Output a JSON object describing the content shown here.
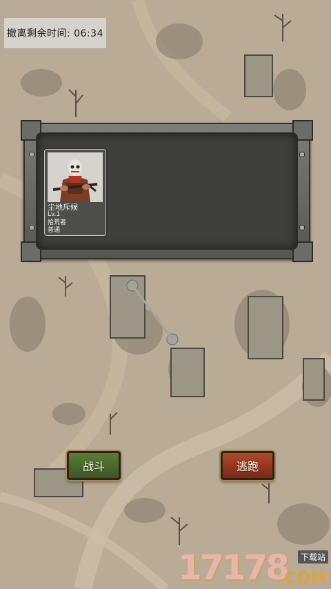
{
  "hud": {
    "timer_text": "撤离剩余时间: 06:34"
  },
  "encounter_panel": {
    "enemy_card": {
      "name": "尘地斥候",
      "level": "Lv.1",
      "class": "拾荒者",
      "rank": "普通"
    }
  },
  "actions": {
    "fight_label": "战斗",
    "flee_label": "逃跑"
  },
  "watermark": {
    "number": "17178",
    "tag": "下载站",
    "suffix": ".COM"
  },
  "colors": {
    "map_sand": "#b9ab96",
    "panel_dark": "#3f403c",
    "fight_green": "#4c6a2f",
    "flee_red": "#9a3a22"
  }
}
